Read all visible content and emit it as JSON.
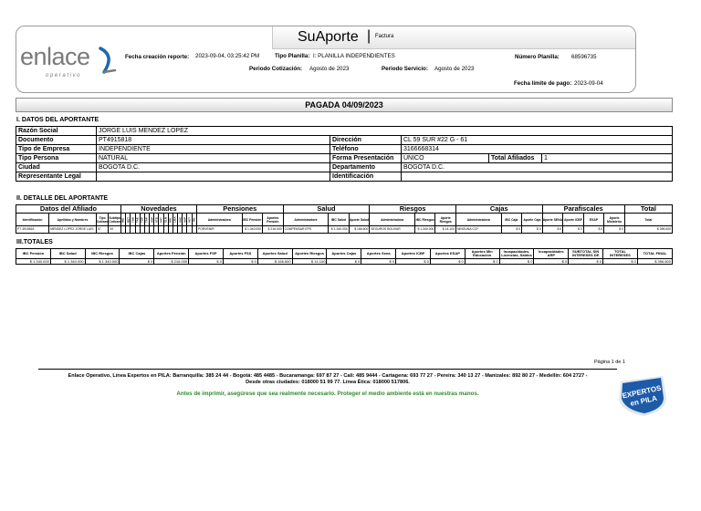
{
  "header": {
    "title": "SuAporte",
    "separator": "|",
    "subtitle": "Factura",
    "logo_text": "enlace",
    "logo_tagline": "operativo",
    "fecha_creacion_label": "Fecha creación reporte:",
    "fecha_creacion_value": "2023-09-04, 03:25:42 PM",
    "tipo_planilla_label": "Tipo Planilla:",
    "tipo_planilla_value": "I: PLANILLA INDEPENDIENTES",
    "numero_planilla_label": "Número Planilla:",
    "numero_planilla_value": "68596735",
    "periodo_cotizacion_label": "Periodo Cotización:",
    "periodo_cotizacion_value": "Agosto de 2023",
    "periodo_servicio_label": "Periodo Servicio:",
    "periodo_servicio_value": "Agosto de 2023",
    "fecha_limite_label": "Fecha límite de pago:",
    "fecha_limite_value": "2023-09-04"
  },
  "status": "PAGADA 04/09/2023",
  "section1": {
    "title": "I. DATOS DEL APORTANTE",
    "razon_social_label": "Razón Social",
    "razon_social_value": "JORGE LUIS MENDEZ LOPEZ",
    "documento_label": "Documento",
    "documento_value": "PT4915818",
    "direccion_label": "Dirección",
    "direccion_value": "CL 59 SUR #22 G - 61",
    "tipo_empresa_label": "Tipo de Empresa",
    "tipo_empresa_value": "INDEPENDIENTE",
    "telefono_label": "Teléfono",
    "telefono_value": "3166668314",
    "tipo_persona_label": "Tipo Persona",
    "tipo_persona_value": "NATURAL",
    "forma_presentacion_label": "Forma Presentación",
    "forma_presentacion_value": "ÚNICO",
    "total_afiliados_label": "Total Afiliados",
    "total_afiliados_value": "1",
    "ciudad_label": "Ciudad",
    "ciudad_value": "BOGOTA D.C.",
    "departamento_label": "Departamento",
    "departamento_value": "BOGOTA D.C.",
    "representante_label": "Representante Legal",
    "representante_value": "",
    "identificacion_label": "Identificación",
    "identificacion_value": ""
  },
  "section2": {
    "title": "II. DETALLE DEL APORTANTE",
    "groups": [
      "Datos del Afiliado",
      "Novedades",
      "Pensiones",
      "Salud",
      "Riesgos",
      "Cajas",
      "Parafiscales",
      "Total"
    ],
    "h_ident": "Identificación",
    "h_nombres": "Apellidos y Nombres",
    "h_tipo": "Tipo Cotizante",
    "h_subtipo": "Subtipo Cotizante",
    "novedades": [
      "ING",
      "RET",
      "TDE",
      "TAE",
      "TDP",
      "TAP",
      "VSP",
      "VTE",
      "VST",
      "SLN",
      "IGE",
      "LMA",
      "VAC",
      "AVP",
      "VCT",
      "IRL"
    ],
    "h_pen_adm": "Administradora",
    "h_pen_ibc": "IBC Pensión",
    "h_pen_ap": "Aportes Pensión",
    "h_sal_adm": "Administradora",
    "h_sal_ibc": "IBC Salud",
    "h_sal_ap": "Aporte Salud",
    "h_rie_adm": "Administradora",
    "h_rie_ibc": "IBC Riesgos",
    "h_rie_ap": "Aporte Riesgos",
    "h_caj_adm": "Administradora",
    "h_caj_ibc": "IBC Caja",
    "h_caj_ap": "Aporte Caja",
    "h_sena": "Aporte SENA",
    "h_icbf": "Aporte ICBF",
    "h_esap": "ESAP",
    "h_min": "Aporte Ministerio",
    "h_total": "Total",
    "row": {
      "ident": "PT 4915818",
      "nombres": "MENDEZ LOPEZ JORGE LUIS",
      "tipo": "57",
      "subtipo": "00",
      "nov": [
        "",
        "",
        "",
        "",
        "",
        "",
        "",
        "",
        "",
        "",
        "",
        "",
        "",
        "",
        "",
        ""
      ],
      "pen_adm": "PORVENIR",
      "pen_ibc": "$ 1.340.000",
      "pen_ap": "$ 216.000",
      "sal_adm": "COMPENSAR EPS",
      "sal_ibc": "$ 1.340.000",
      "sal_ap": "$ 166.600",
      "rie_adm": "SEGUROS BOLIVAR",
      "rie_ibc": "$ 1.340.000",
      "rie_ap": "$ 14.100",
      "caj_adm": "NINGUNA CCF",
      "caj_ibc": "$ 0",
      "caj_ap": "$ 0",
      "sena": "$ 0",
      "icbf": "$ 0",
      "esap": "$ 0",
      "min": "$ 0",
      "total": "$ 396.600"
    }
  },
  "section3": {
    "title": "III.TOTALES",
    "headers": [
      "IBC Pensión",
      "IBC Salud",
      "IBC Riesgos",
      "IBC Cajas",
      "Aportes Pensión",
      "Aportes FSP",
      "Aportes FSS",
      "Aportes Salud",
      "Aportes Riesgos",
      "Aportes Cajas",
      "Aportes Sena",
      "Aportes ICBF",
      "Aportes ESAP",
      "Aportes Min Educación",
      "Incapacidades, Licencias, Saldos",
      "Incapacidades ARP",
      "SUBTOTAL SIN INTERESES DE",
      "TOTAL INTERESES",
      "TOTAL FINAL"
    ],
    "values": [
      "$ 1.340.000",
      "$ 1.340.000",
      "$ 1.340.000",
      "$ 0",
      "$ 216.000",
      "$ 0",
      "$ 0",
      "$ 166.600",
      "$ 14.100",
      "$ 0",
      "$ 0",
      "$ 0",
      "$ 0",
      "$ 0",
      "$ 0",
      "$ 0",
      "$ 0",
      "$ 0",
      "$ 396.600"
    ]
  },
  "footer": {
    "pagina": "Página 1 de 1",
    "contact_line1": "Enlace Operativo, Línea Expertos en PILA: Barranquilla: 385 24 44 - Bogotá: 485 4485 - Bucaramanga: 697 87 27 - Cali: 485 9444 - Cartagena: 693 77 27 - Pereira: 340 13 27 - Manizales: 892 80 27 - Medellín: 604 2727 -",
    "contact_line2": "Desde otras ciudades: 018000 51 99 77. Línea Ética: 018000 517806.",
    "green_note": "Antes de imprimir, asegúrese que sea realmente necesario. Proteger el medio ambiente está en nuestras manos.",
    "badge_line1": "EXPERTOS",
    "badge_line2": "en PILA"
  },
  "colors": {
    "logo_gray": "#7a7a7a",
    "logo_blue": "#1f66b0",
    "green": "#2e8b2e",
    "badge_blue": "#1d5aa8"
  }
}
